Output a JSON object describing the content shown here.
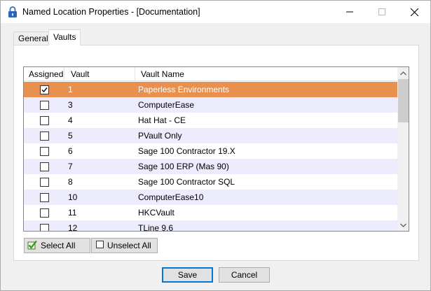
{
  "window": {
    "title": "Named Location Properties - [Documentation]"
  },
  "tabs": [
    {
      "label": "General"
    },
    {
      "label": "Vaults"
    }
  ],
  "grid": {
    "columns": [
      "Assigned",
      "Vault",
      "Vault Name"
    ],
    "rows": [
      {
        "assigned": true,
        "vault": "1",
        "name": "Paperless Environments",
        "selected": true
      },
      {
        "assigned": false,
        "vault": "3",
        "name": "ComputerEase"
      },
      {
        "assigned": false,
        "vault": "4",
        "name": "Hat Hat - CE"
      },
      {
        "assigned": false,
        "vault": "5",
        "name": "PVault Only"
      },
      {
        "assigned": false,
        "vault": "6",
        "name": "Sage 100 Contractor 19.X"
      },
      {
        "assigned": false,
        "vault": "7",
        "name": "Sage 100 ERP (Mas 90)"
      },
      {
        "assigned": false,
        "vault": "8",
        "name": "Sage 100 Contractor SQL"
      },
      {
        "assigned": false,
        "vault": "10",
        "name": "ComputerEase10"
      },
      {
        "assigned": false,
        "vault": "11",
        "name": "HKCVault"
      },
      {
        "assigned": false,
        "vault": "12",
        "name": "TLine 9.6"
      }
    ]
  },
  "buttons": {
    "select_all": "Select All",
    "unselect_all": "Unselect All",
    "save": "Save",
    "cancel": "Cancel"
  },
  "colors": {
    "selected_row": "#e8914f",
    "alt_row": "#ececfc",
    "default_button_border": "#0078d7"
  }
}
